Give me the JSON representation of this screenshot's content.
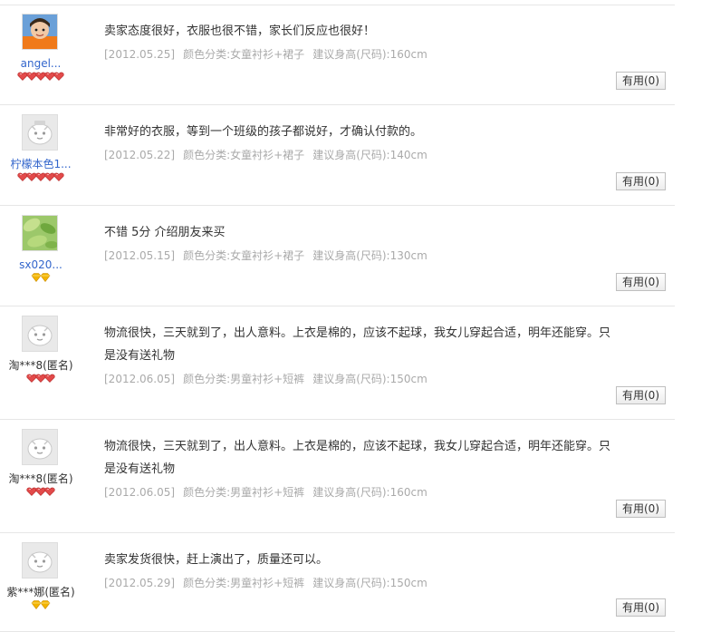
{
  "reviews": [
    {
      "username": "angel...",
      "name_style": "link",
      "avatar": "photo-child-orange",
      "rank_icon": "red-heart-icon",
      "rank_count": 5,
      "content": "卖家态度很好，衣服也很不错，家长们反应也很好！",
      "date": "[2012.05.25]",
      "sku": "颜色分类:女童衬衫+裙子",
      "size": "建议身高(尺码):160cm",
      "useful_label": "有用(0)"
    },
    {
      "username": "柠檬本色1...",
      "name_style": "link",
      "avatar": "default-face-avatar-taobao",
      "rank_icon": "red-heart-icon",
      "rank_count": 5,
      "content": "非常好的衣服，等到一个班级的孩子都说好，才确认付款的。",
      "date": "[2012.05.22]",
      "sku": "颜色分类:女童衬衫+裙子",
      "size": "建议身高(尺码):140cm",
      "useful_label": "有用(0)"
    },
    {
      "username": "sx020...",
      "name_style": "link",
      "avatar": "photo-green-leaves",
      "rank_icon": "yellow-diamond-icon",
      "rank_count": 2,
      "content": "不错 5分 介绍朋友来买",
      "date": "[2012.05.15]",
      "sku": "颜色分类:女童衬衫+裙子",
      "size": "建议身高(尺码):130cm",
      "useful_label": "有用(0)"
    },
    {
      "username": "淘***8(匿名)",
      "name_style": "plain",
      "avatar": "default-face-avatar",
      "rank_icon": "red-heart-icon",
      "rank_count": 3,
      "content": "物流很快，三天就到了，出人意料。上衣是棉的，应该不起球，我女儿穿起合适，明年还能穿。只是没有送礼物",
      "date": "[2012.06.05]",
      "sku": "颜色分类:男童衬衫+短裤",
      "size": "建议身高(尺码):150cm",
      "useful_label": "有用(0)"
    },
    {
      "username": "淘***8(匿名)",
      "name_style": "plain",
      "avatar": "default-face-avatar",
      "rank_icon": "red-heart-icon",
      "rank_count": 3,
      "content": "物流很快，三天就到了，出人意料。上衣是棉的，应该不起球，我女儿穿起合适，明年还能穿。只是没有送礼物",
      "date": "[2012.06.05]",
      "sku": "颜色分类:男童衬衫+短裤",
      "size": "建议身高(尺码):160cm",
      "useful_label": "有用(0)"
    },
    {
      "username": "紫***娜(匿名)",
      "name_style": "plain",
      "avatar": "default-face-avatar",
      "rank_icon": "yellow-diamond-icon",
      "rank_count": 2,
      "content": "卖家发货很快，赶上演出了，质量还可以。",
      "date": "[2012.05.29]",
      "sku": "颜色分类:男童衬衫+短裤",
      "size": "建议身高(尺码):150cm",
      "useful_label": "有用(0)"
    }
  ],
  "colors": {
    "link": "#3366cc",
    "meta": "#aaaaaa",
    "divider": "#e6e6e6",
    "heart": "#e24a4a",
    "diamond": "#f2b300"
  }
}
